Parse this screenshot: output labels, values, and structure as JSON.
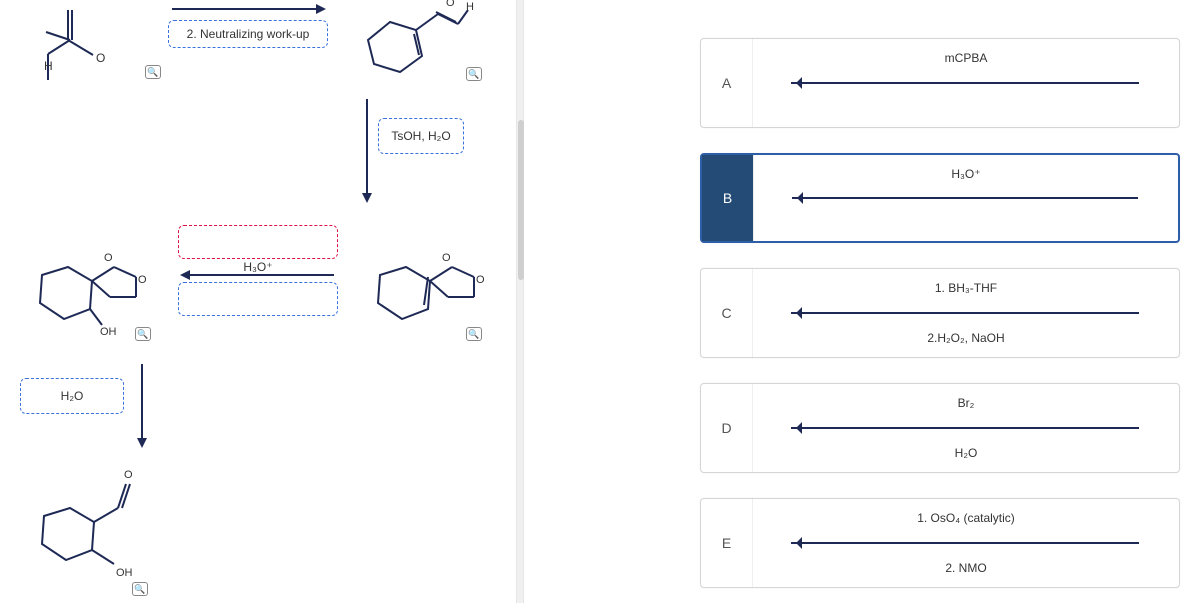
{
  "left": {
    "step2_label": "2. Neutralizing work-up",
    "tsoh_label": "TsOH, H₂O",
    "h3o_label": "H₃O⁺",
    "h2o_label": "H₂O",
    "oh_label_1": "OH",
    "oh_label_2": "OH",
    "h_atom_1": "H",
    "h_atom_2": "H",
    "o_atom_1": "O",
    "o_atom_2": "O",
    "o_atom_3": "O",
    "o_atom_4": "O",
    "o_atom_5": "O",
    "o_atom_6": "O",
    "zoom_glyph": "🔍"
  },
  "options": [
    {
      "letter": "A",
      "top": "mCPBA",
      "bottom": "",
      "selected": false
    },
    {
      "letter": "B",
      "top": "H₃O⁺",
      "bottom": "",
      "selected": true
    },
    {
      "letter": "C",
      "top": "1. BH₃-THF",
      "bottom": "2.H₂O₂, NaOH",
      "selected": false
    },
    {
      "letter": "D",
      "top": "Br₂",
      "bottom": "H₂O",
      "selected": false
    },
    {
      "letter": "E",
      "top": "1. OsO₄ (catalytic)",
      "bottom": "2. NMO",
      "selected": false
    }
  ]
}
